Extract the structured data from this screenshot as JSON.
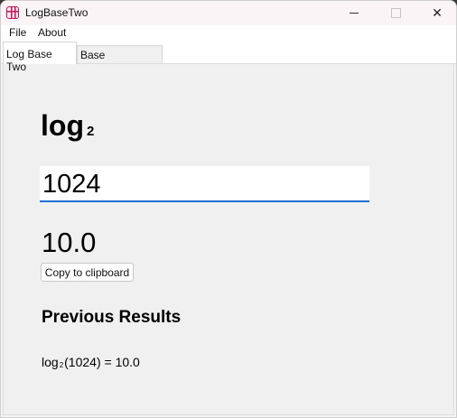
{
  "window": {
    "title": "LogBaseTwo",
    "icon": "calculator-app-icon",
    "controls": {
      "minimize_icon": "minimize-icon",
      "maximize_icon": "maximize-icon",
      "close_icon": "close-icon",
      "close_glyph": "✕"
    }
  },
  "menu": {
    "items": [
      "File",
      "About"
    ]
  },
  "tabs": [
    {
      "label": "Log Base Two",
      "selected": true
    },
    {
      "label": "Base Conversion",
      "selected": false
    }
  ],
  "main": {
    "log_label": "log",
    "log_base": "2",
    "input_value": "1024",
    "result": "10.0",
    "copy_button_label": "Copy to clipboard",
    "previous_results_title": "Previous Results",
    "history": [
      {
        "prefix": "log",
        "base": "2",
        "expression": "(1024) = 10.0"
      }
    ]
  },
  "colors": {
    "input_focus_underline": "#1f6ed4",
    "app_icon_accent": "#c2185b"
  }
}
